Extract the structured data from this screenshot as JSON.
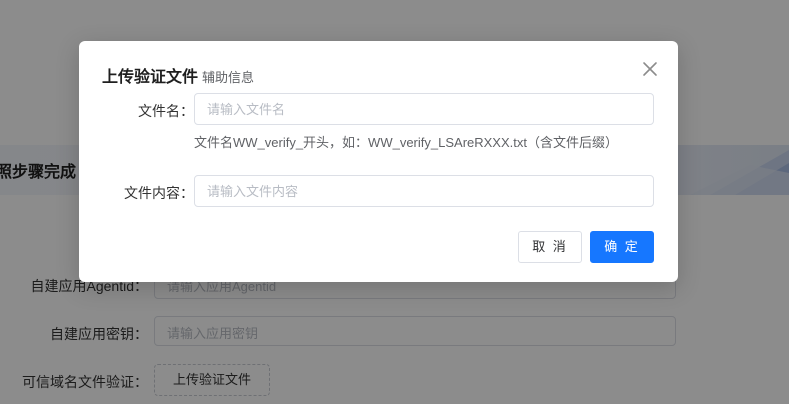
{
  "background": {
    "banner_title": "照步骤完成",
    "rows": [
      {
        "label": "自建应用Agentid：",
        "placeholder": "请输入应用Agentid"
      },
      {
        "label": "自建应用密钥：",
        "placeholder": "请输入应用密钥"
      },
      {
        "label": "可信域名文件验证："
      }
    ],
    "upload_button": "上传验证文件"
  },
  "dialog": {
    "title": "上传验证文件",
    "subtitle": "辅助信息",
    "close_icon": "close-icon",
    "fields": [
      {
        "label": "文件名：",
        "placeholder": "请输入文件名",
        "value": ""
      },
      {
        "label": "文件内容：",
        "placeholder": "请输入文件内容",
        "value": ""
      }
    ],
    "hint": "文件名WW_verify_开头，如：WW_verify_LSAreRXXX.txt（含文件后缀）",
    "cancel_label": "取 消",
    "confirm_label": "确 定"
  },
  "colors": {
    "primary": "#1677ff",
    "overlay": "rgba(0,0,0,0.45)",
    "border": "#dcdfe6"
  }
}
